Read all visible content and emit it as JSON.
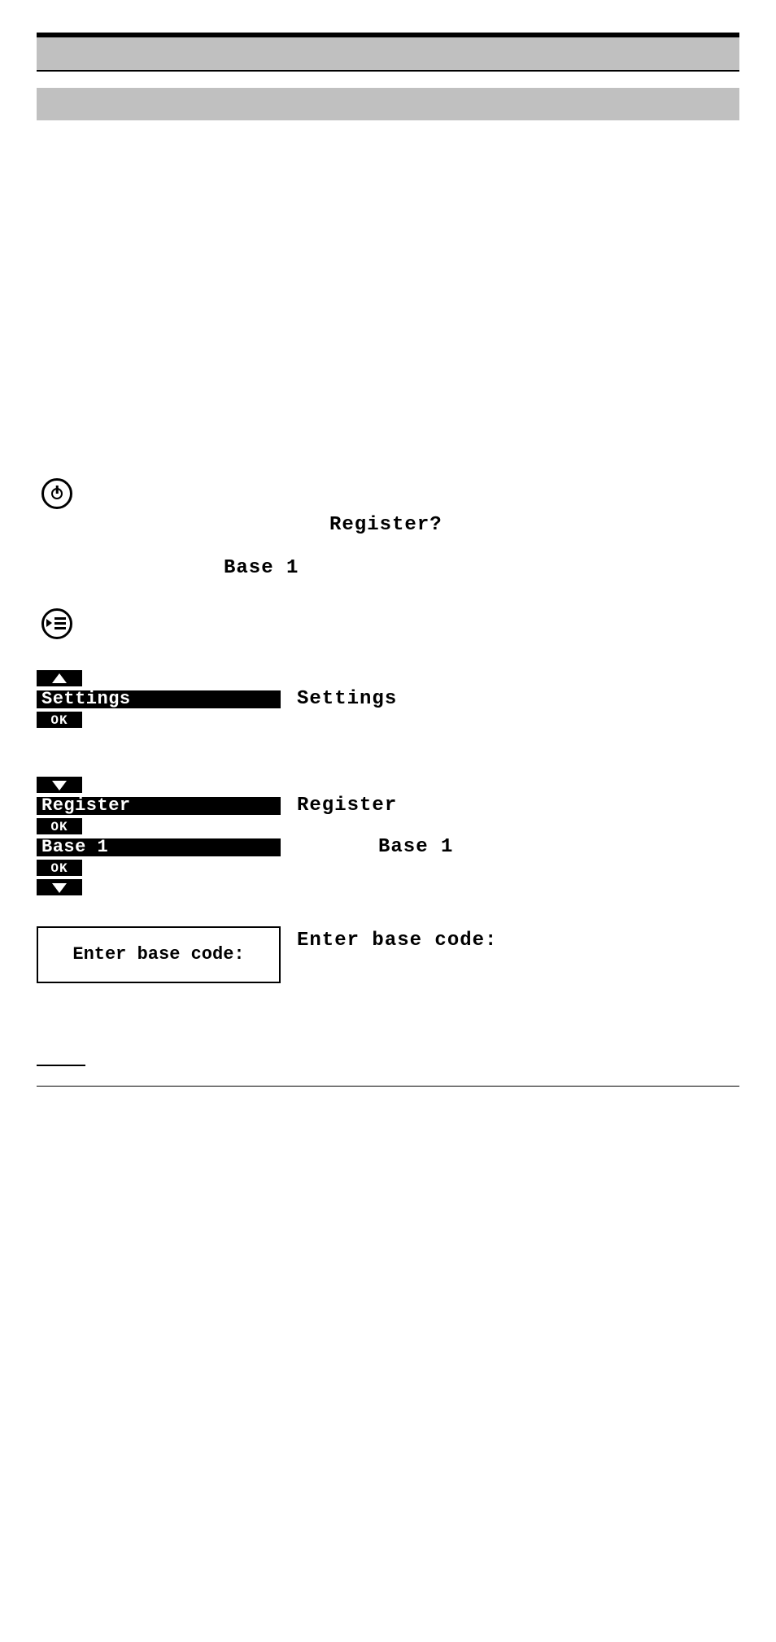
{
  "text": {
    "register_prompt": "Register?",
    "base1": "Base 1",
    "settings": "Settings",
    "register": "Register",
    "enter_base_code": "Enter base code:"
  },
  "lcd": {
    "settings": "Settings",
    "register": "Register",
    "base1": "Base 1",
    "enter_base_code": "Enter base code:"
  },
  "buttons": {
    "ok": "OK"
  },
  "icons": {
    "power": "power-icon",
    "menu": "menu-icon",
    "up": "up-arrow",
    "down": "down-arrow"
  }
}
